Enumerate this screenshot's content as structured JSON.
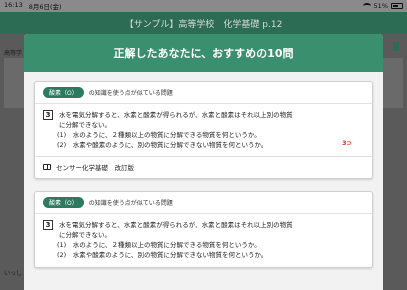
{
  "statusbar": {
    "time": "16:13",
    "date": "8月6日(金)",
    "battery": "51%"
  },
  "app": {
    "header_title": "【サンプル】高等学校　化学基礎 p.12",
    "bg_label": "高等学",
    "bg_bottom": "いっし"
  },
  "modal": {
    "title": "正解したあなたに、おすすめの10問",
    "cards": [
      {
        "tag": "酸素（O）",
        "tag_note": "の知識を使う点が似ている問題",
        "number": "3",
        "lines": [
          "水を電気分解すると、水素と酸素が得られるが、水素と酸素はそれ以上別の物質",
          "に分解できない。"
        ],
        "subs": [
          "(1)　水のように、２種類以上の物質に分解できる物質を何というか。",
          "(2)　水素や酸素のように、別の物質に分解できない物質を何というか。"
        ],
        "answer_mark": "3⊃",
        "source": "センサー化学基礎　改訂版"
      },
      {
        "tag": "酸素（O）",
        "tag_note": "の知識を使う点が似ている問題",
        "number": "3",
        "lines": [
          "水を電気分解すると、水素と酸素が得られるが、水素と酸素はそれ以上別の物質",
          "に分解できない。"
        ],
        "subs": [
          "(1)　水のように、２種類以上の物質に分解できる物質を何というか。",
          "(2)　水素や酸素のように、別の物質に分解できない物質を何というか。"
        ]
      }
    ]
  },
  "colors": {
    "accent": "#3a8f6e",
    "tag": "#2c7a5f",
    "mark": "#d9342b"
  }
}
